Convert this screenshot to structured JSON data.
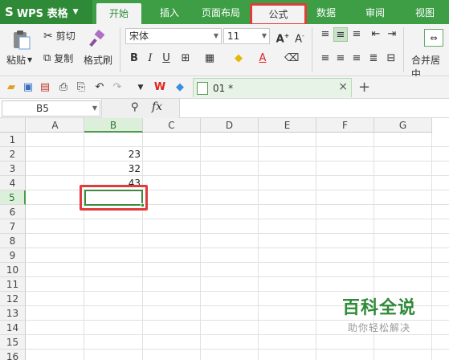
{
  "app": {
    "name": "WPS 表格",
    "logo": "S"
  },
  "tabs": [
    "开始",
    "插入",
    "页面布局",
    "公式",
    "数据",
    "审阅",
    "视图"
  ],
  "active_tab": "开始",
  "highlighted_tab": "公式",
  "ribbon": {
    "paste": "粘贴",
    "cut": "剪切",
    "copy": "复制",
    "format_painter": "格式刷",
    "font_name": "宋体",
    "font_size": "11",
    "merge_center": "合并居中"
  },
  "document": {
    "tab_name": "01 *"
  },
  "formula_bar": {
    "name_box": "B5",
    "fx": "fx"
  },
  "grid": {
    "columns": [
      "A",
      "B",
      "C",
      "D",
      "E",
      "F",
      "G"
    ],
    "rows": [
      "1",
      "2",
      "3",
      "4",
      "5",
      "6",
      "7",
      "8",
      "9",
      "10",
      "11",
      "12",
      "13",
      "14",
      "15",
      "16"
    ],
    "selected_cell": "B5",
    "cells": [
      {
        "ref": "B2",
        "value": "23"
      },
      {
        "ref": "B3",
        "value": "32"
      },
      {
        "ref": "B4",
        "value": "43"
      }
    ]
  },
  "watermark": {
    "title": "百科全说",
    "subtitle": "助你轻松解决"
  },
  "colors": {
    "accent": "#3d9e46",
    "highlight": "#e03c3c"
  }
}
